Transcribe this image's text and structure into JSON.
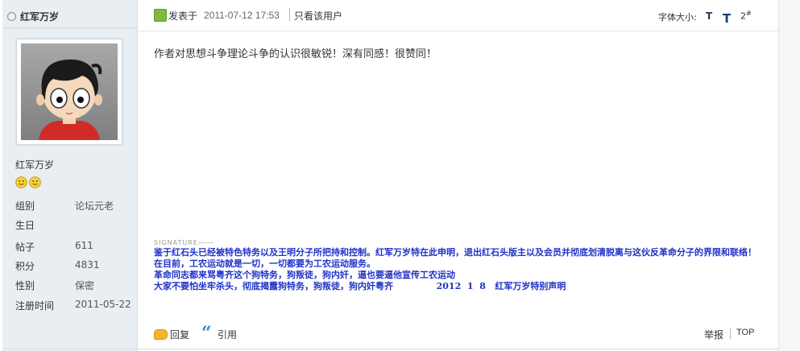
{
  "author": {
    "name": "红军万岁",
    "name_side": "红军万岁",
    "info": [
      {
        "key": "组别",
        "value": "论坛元老"
      },
      {
        "key": "生日",
        "value": ""
      },
      {
        "key": "帖子",
        "value": "611"
      },
      {
        "key": "积分",
        "value": "4831"
      },
      {
        "key": "性别",
        "value": "保密"
      },
      {
        "key": "注册时间",
        "value": "2011-05-22"
      }
    ],
    "medal_count": 2
  },
  "post": {
    "posted_label": "发表于",
    "timestamp": "2011-07-12 17:53",
    "only_author": "只看该用户",
    "font_size_label": "字体大小:",
    "font_small": "T",
    "font_large": "T",
    "floor": "2",
    "floor_suffix": "#",
    "body": "作者对思想斗争理论斗争的认识很敏锐！深有同感！很赞同！",
    "signature_label": "SIGNATURE:",
    "signature_lines": [
      "鉴于红石头已经被特色特务以及王明分子所把持和控制。红军万岁特在此申明，退出红石头版主以及会员并彻底划清脱离与这伙反革命分子的界限和联络！",
      "在目前，工农运动就是一切，一切都要为工农运动服务。",
      "革命同志都来骂粤齐这个狗特务，狗叛徒，狗内奸，逼也要逼他宣传工农运动",
      "大家不要怕坐牢杀头，彻底揭露狗特务，狗叛徒，狗内奸粤齐              2012  1  8   红军万岁特别声明"
    ]
  },
  "footer": {
    "reply": "回复",
    "quote": "引用",
    "report": "举报",
    "top": "TOP"
  },
  "colors": {
    "sidebar_bg": "#e9eef3",
    "signature": "#1f31c8",
    "reply_icon": "#f3b52b",
    "quote_icon": "#3f86c8"
  }
}
